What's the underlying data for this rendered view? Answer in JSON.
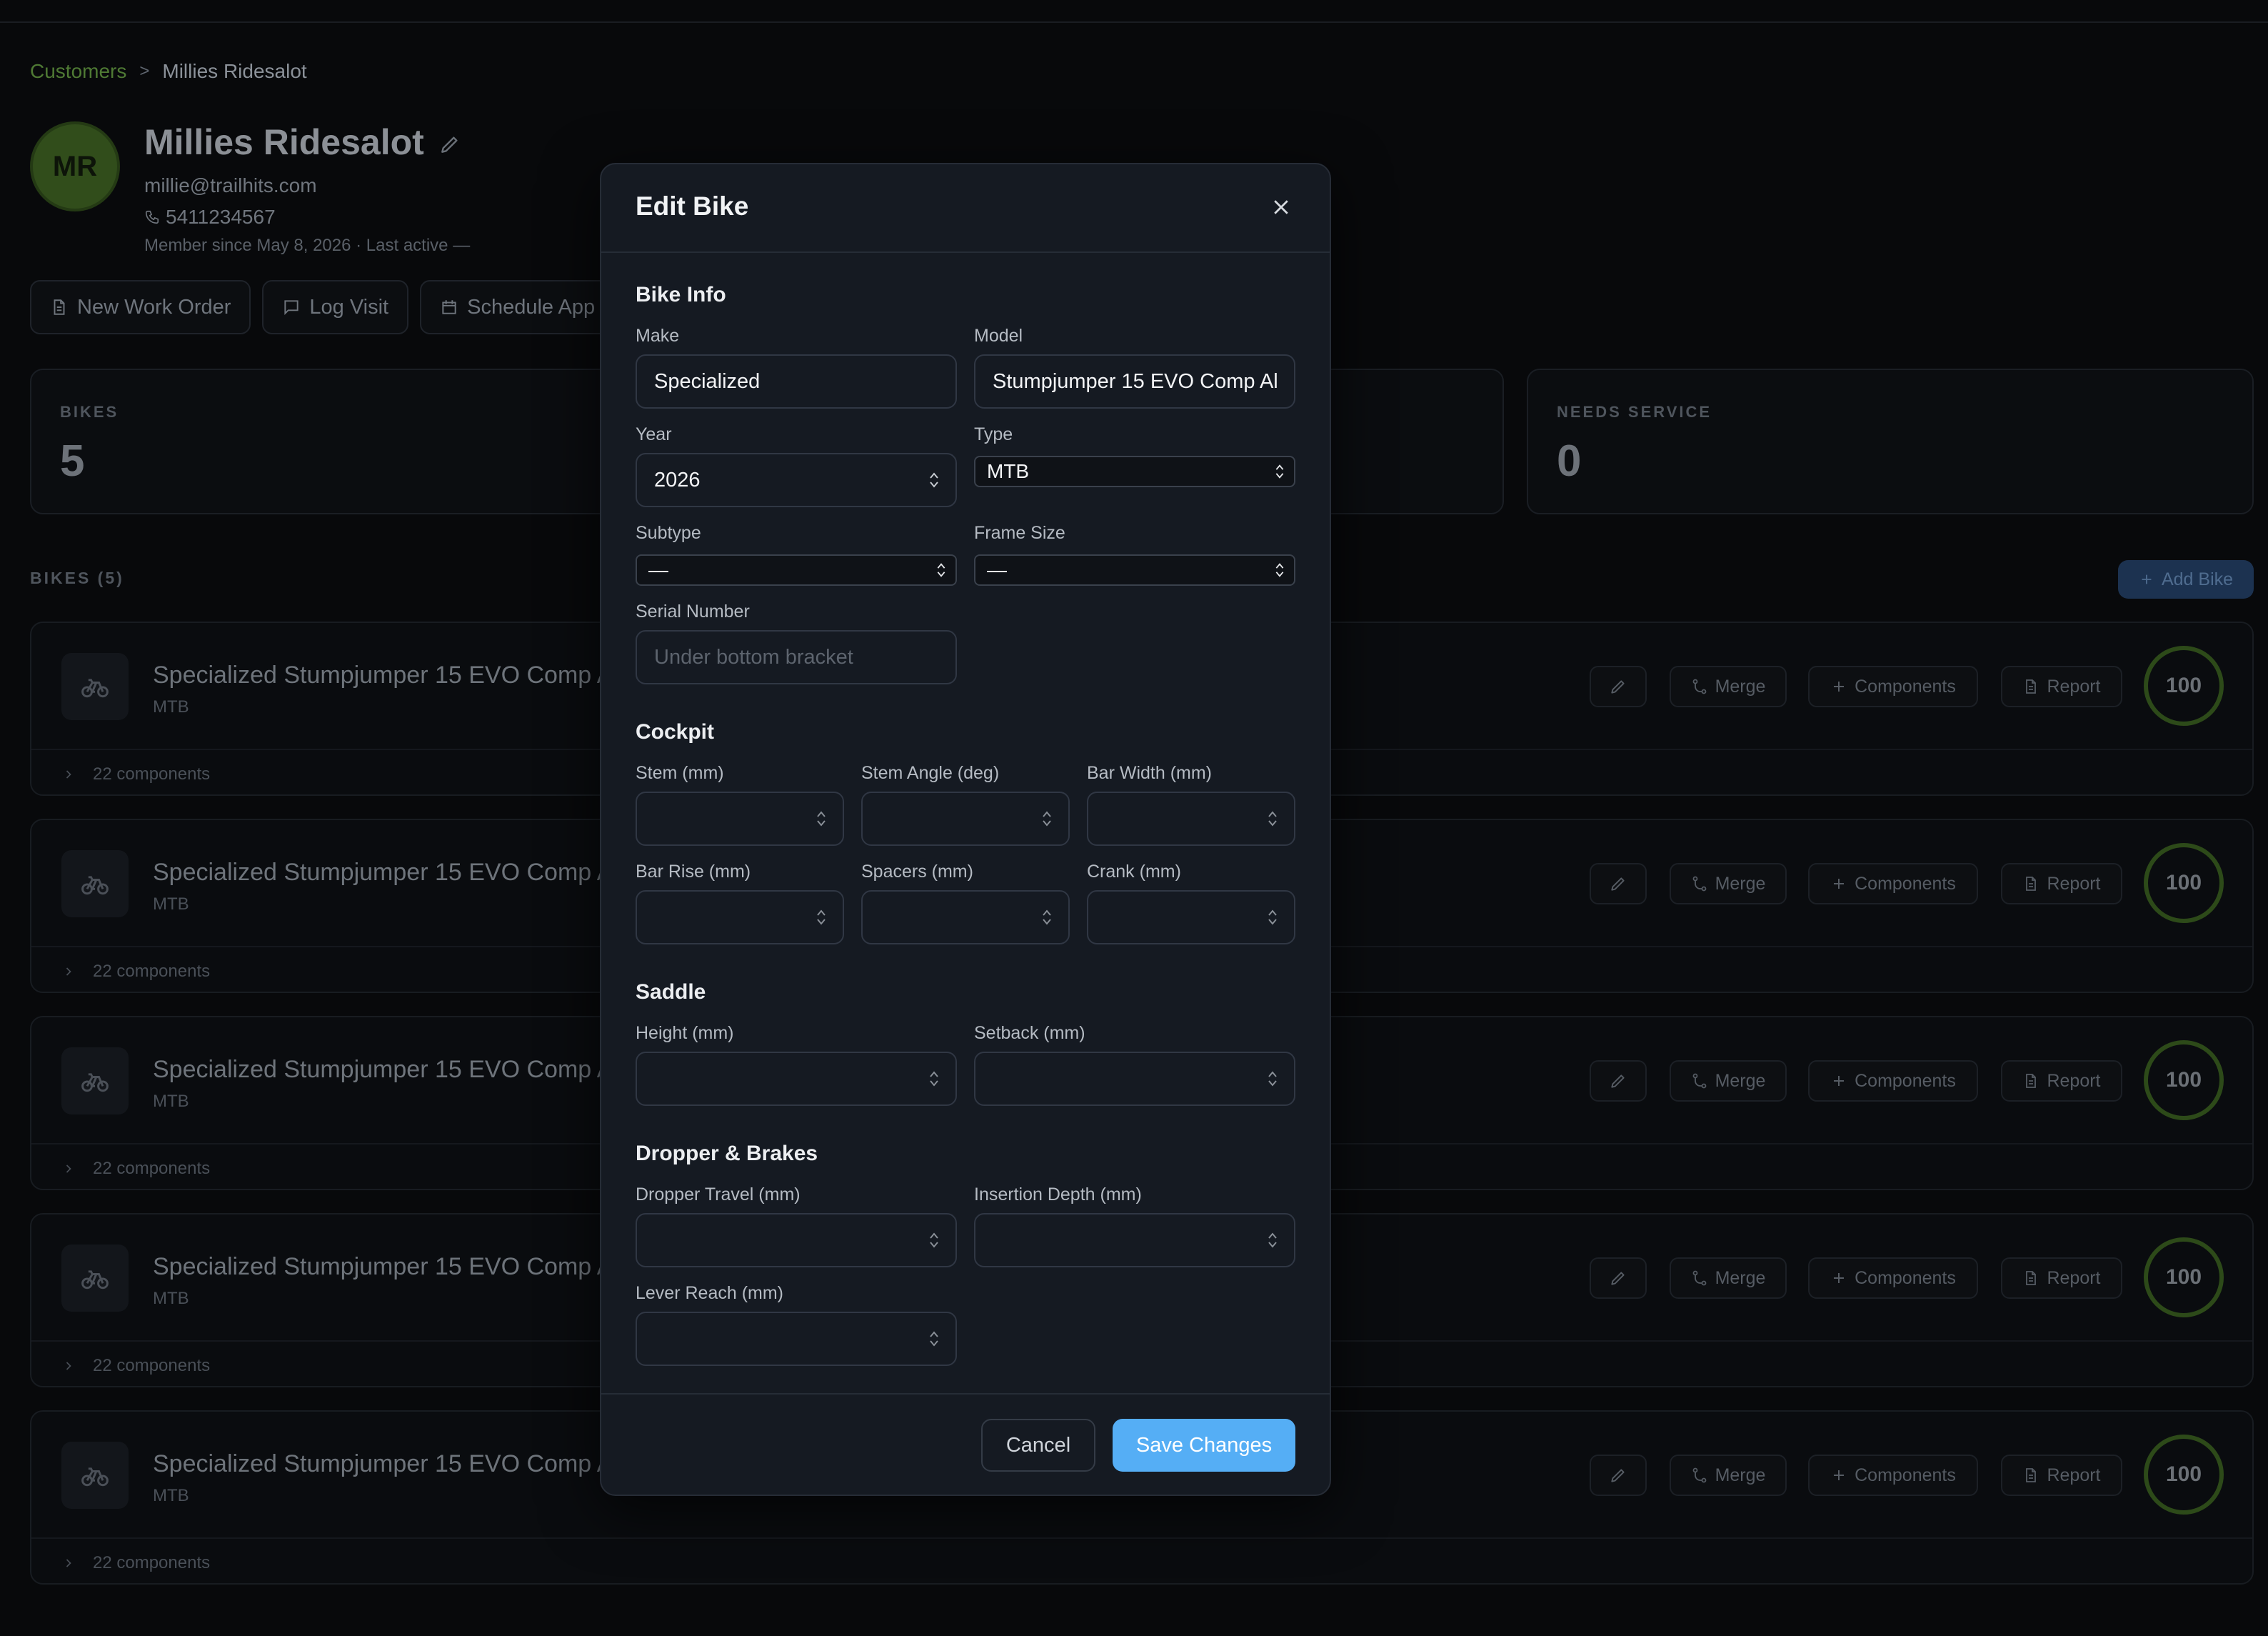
{
  "breadcrumb": {
    "parent": "Customers",
    "separator": ">",
    "current": "Millies Ridesalot"
  },
  "customer": {
    "initials": "MR",
    "name": "Millies Ridesalot",
    "email": "millie@trailhits.com",
    "phone": "5411234567",
    "since": "Member since May 8, 2026 · Last active —"
  },
  "actions": {
    "new_work_order": "New Work Order",
    "log_visit": "Log Visit",
    "schedule": "Schedule App"
  },
  "stats": [
    {
      "label": "BIKES",
      "value": "5"
    },
    {
      "label": "NEEDS SERVICE",
      "value": "0"
    }
  ],
  "bikes_section": {
    "label": "BIKES (5)",
    "add_label": "Add Bike"
  },
  "bike_card": {
    "title": "Specialized Stumpjumper 15 EVO Comp A",
    "type": "MTB",
    "merge": "Merge",
    "components_btn": "Components",
    "report": "Report",
    "score": "100",
    "components": "22 components"
  },
  "modal": {
    "title": "Edit Bike",
    "sections": {
      "bike_info": "Bike Info",
      "cockpit": "Cockpit",
      "saddle": "Saddle",
      "dropper": "Dropper & Brakes"
    },
    "fields": {
      "make_label": "Make",
      "make_value": "Specialized",
      "model_label": "Model",
      "model_value": "Stumpjumper 15 EVO Comp Al",
      "year_label": "Year",
      "year_value": "2026",
      "type_label": "Type",
      "type_value": "MTB",
      "subtype_label": "Subtype",
      "subtype_value": "—",
      "frame_label": "Frame Size",
      "frame_value": "—",
      "serial_label": "Serial Number",
      "serial_placeholder": "Under bottom bracket",
      "stem_label": "Stem (mm)",
      "stem_angle_label": "Stem Angle (deg)",
      "bar_width_label": "Bar Width (mm)",
      "bar_rise_label": "Bar Rise (mm)",
      "spacers_label": "Spacers (mm)",
      "crank_label": "Crank (mm)",
      "height_label": "Height (mm)",
      "setback_label": "Setback (mm)",
      "dropper_travel_label": "Dropper Travel (mm)",
      "insertion_label": "Insertion Depth (mm)",
      "lever_label": "Lever Reach (mm)"
    },
    "cancel": "Cancel",
    "save": "Save Changes"
  },
  "colors": {
    "accent": "#55aef5",
    "brand_green": "#314d1b",
    "modal_bg": "#151a22"
  }
}
